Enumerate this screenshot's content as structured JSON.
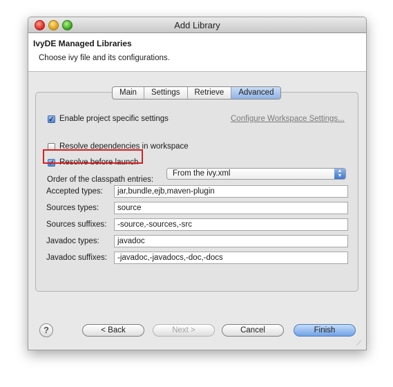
{
  "window": {
    "title": "Add Library"
  },
  "header": {
    "title": "IvyDE Managed Libraries",
    "description": "Choose ivy file and its configurations."
  },
  "tabs": [
    {
      "label": "Main",
      "active": false
    },
    {
      "label": "Settings",
      "active": false
    },
    {
      "label": "Retrieve",
      "active": false
    },
    {
      "label": "Advanced",
      "active": true
    }
  ],
  "advanced": {
    "enable_project_settings": {
      "label": "Enable project specific settings",
      "checked": true
    },
    "configure_workspace_link": "Configure Workspace Settings...",
    "resolve_in_workspace": {
      "label": "Resolve dependencies in workspace",
      "checked": false
    },
    "resolve_before_launch": {
      "label": "Resolve before launch",
      "checked": true
    },
    "classpath_order": {
      "label": "Order of the classpath entries:",
      "value": "From the ivy.xml"
    },
    "fields": {
      "accepted_types": {
        "label": "Accepted types:",
        "value": "jar,bundle,ejb,maven-plugin"
      },
      "sources_types": {
        "label": "Sources types:",
        "value": "source"
      },
      "sources_suffixes": {
        "label": "Sources suffixes:",
        "value": "-source,-sources,-src"
      },
      "javadoc_types": {
        "label": "Javadoc types:",
        "value": "javadoc"
      },
      "javadoc_suffixes": {
        "label": "Javadoc suffixes:",
        "value": "-javadoc,-javadocs,-doc,-docs"
      }
    }
  },
  "footer": {
    "help_icon": "question-mark-icon",
    "back_label": "< Back",
    "next_label": "Next >",
    "cancel_label": "Cancel",
    "finish_label": "Finish"
  },
  "colors": {
    "highlight_border": "#d62020",
    "accent": "#4f86d2"
  }
}
